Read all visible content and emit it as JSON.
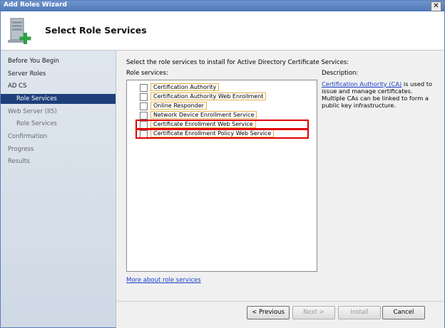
{
  "window": {
    "title": "Add Roles Wizard",
    "close_label": "✕"
  },
  "header": {
    "title": "Select Role Services",
    "icon": "server-add-icon"
  },
  "nav": {
    "items": [
      {
        "label": "Before You Begin",
        "state": "normal"
      },
      {
        "label": "Server Roles",
        "state": "normal"
      },
      {
        "label": "AD CS",
        "state": "normal"
      },
      {
        "label": "Role Services",
        "state": "active"
      },
      {
        "label": "Web Server (IIS)",
        "state": "dim"
      },
      {
        "label": "Role Services",
        "state": "dim"
      },
      {
        "label": "Confirmation",
        "state": "dim"
      },
      {
        "label": "Progress",
        "state": "dim"
      },
      {
        "label": "Results",
        "state": "dim"
      }
    ]
  },
  "content": {
    "intro": "Select the role services to install for Active Directory Certificate Services:",
    "role_services_label": "Role services:",
    "services": [
      {
        "label": "Certification Authority",
        "checked": false
      },
      {
        "label": "Certification Authority Web Enrollment",
        "checked": false
      },
      {
        "label": "Online Responder",
        "checked": false
      },
      {
        "label": "Network Device Enrollment Service",
        "checked": false
      },
      {
        "label": "Certificate Enrollment Web Service",
        "checked": false
      },
      {
        "label": "Certificate Enrollment Policy Web Service",
        "checked": false
      }
    ],
    "description_label": "Description:",
    "description_link": "Certification Authority (CA)",
    "description_text": " is used to issue and manage certificates. Multiple CAs can be linked to form a public key infrastructure.",
    "more_link": "More about role services"
  },
  "buttons": {
    "previous": "< Previous",
    "next": "Next >",
    "install": "Install",
    "cancel": "Cancel"
  },
  "colors": {
    "highlight_border": "#e00000",
    "nav_active": "#1f3f7a",
    "link": "#1a3fc8"
  }
}
